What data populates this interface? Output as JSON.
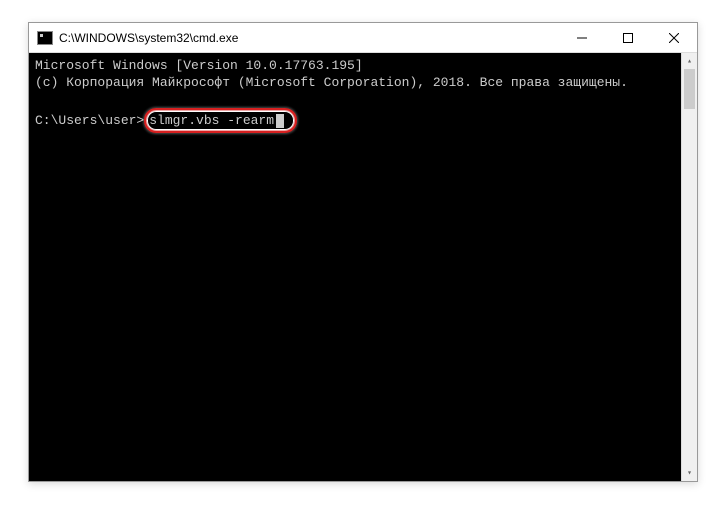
{
  "window": {
    "title": "C:\\WINDOWS\\system32\\cmd.exe"
  },
  "terminal": {
    "line1": "Microsoft Windows [Version 10.0.17763.195]",
    "line2": "(c) Корпорация Майкрософт (Microsoft Corporation), 2018. Все права защищены.",
    "prompt": "C:\\Users\\user>",
    "command": "slmgr.vbs -rearm"
  }
}
